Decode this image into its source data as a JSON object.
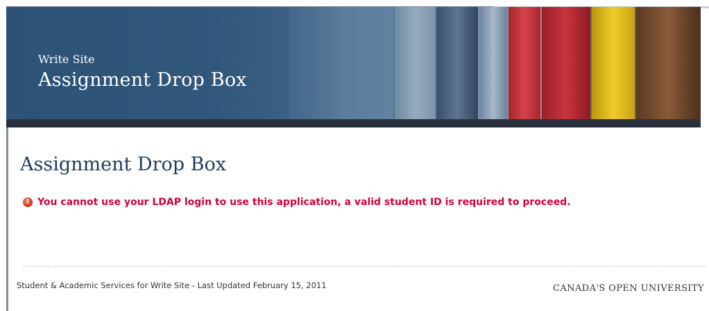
{
  "header": {
    "site_name": "Write Site",
    "title": "Assignment Drop Box"
  },
  "main": {
    "page_title": "Assignment Drop Box",
    "error_message": "You cannot use your LDAP login to use this application, a valid student ID is required to proceed.",
    "error_icon": "error-icon"
  },
  "footer": {
    "text": "Student & Academic Services for Write Site - Last Updated February 15, 2011",
    "org": "CANADA'S OPEN UNIVERSITY"
  },
  "colors": {
    "banner_blue": "#2f5578",
    "title_blue": "#1e3a5f",
    "error_red": "#d1003a"
  }
}
